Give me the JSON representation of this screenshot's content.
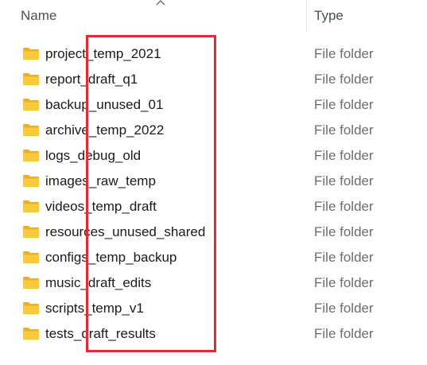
{
  "header": {
    "name_label": "Name",
    "type_label": "Type"
  },
  "icons": {
    "folder": "folder-icon",
    "sort": "chevron-up-icon"
  },
  "colors": {
    "folder_fill": "#f8c93a",
    "folder_back": "#e8b12a",
    "highlight_border": "#e32b36"
  },
  "rows": [
    {
      "name": "project_temp_2021",
      "type": "File folder"
    },
    {
      "name": "report_draft_q1",
      "type": "File folder"
    },
    {
      "name": "backup_unused_01",
      "type": "File folder"
    },
    {
      "name": "archive_temp_2022",
      "type": "File folder"
    },
    {
      "name": "logs_debug_old",
      "type": "File folder"
    },
    {
      "name": "images_raw_temp",
      "type": "File folder"
    },
    {
      "name": "videos_temp_draft",
      "type": "File folder"
    },
    {
      "name": "resources_unused_shared",
      "type": "File folder"
    },
    {
      "name": "configs_temp_backup",
      "type": "File folder"
    },
    {
      "name": "music_draft_edits",
      "type": "File folder"
    },
    {
      "name": "scripts_temp_v1",
      "type": "File folder"
    },
    {
      "name": "tests_draft_results",
      "type": "File folder"
    }
  ]
}
